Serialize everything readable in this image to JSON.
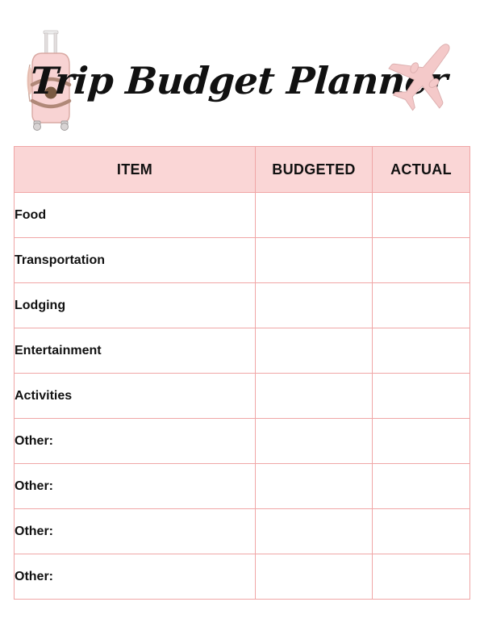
{
  "header": {
    "title": "Trip Budget Planner",
    "icons": {
      "left": "suitcase-icon",
      "right": "airplane-icon"
    }
  },
  "colors": {
    "header_fill": "#FAD6D6",
    "border": "#F0A6A6",
    "suitcase_body": "#F8D3D3",
    "suitcase_strap": "#B08878",
    "suitcase_lock": "#7A5A42",
    "suitcase_handle": "#E4E4E4",
    "plane": "#F4C9C9",
    "text": "#111111",
    "page_background": "#FFFFFF"
  },
  "table": {
    "columns": [
      {
        "key": "item",
        "label": "ITEM",
        "align": "center"
      },
      {
        "key": "budgeted",
        "label": "BUDGETED",
        "align": "center"
      },
      {
        "key": "actual",
        "label": "ACTUAL",
        "align": "center"
      }
    ],
    "rows": [
      {
        "item": "Food",
        "budgeted": "",
        "actual": ""
      },
      {
        "item": "Transportation",
        "budgeted": "",
        "actual": ""
      },
      {
        "item": "Lodging",
        "budgeted": "",
        "actual": ""
      },
      {
        "item": "Entertainment",
        "budgeted": "",
        "actual": ""
      },
      {
        "item": "Activities",
        "budgeted": "",
        "actual": ""
      },
      {
        "item": "Other:",
        "budgeted": "",
        "actual": ""
      },
      {
        "item": "Other:",
        "budgeted": "",
        "actual": ""
      },
      {
        "item": "Other:",
        "budgeted": "",
        "actual": ""
      },
      {
        "item": "Other:",
        "budgeted": "",
        "actual": ""
      }
    ]
  }
}
